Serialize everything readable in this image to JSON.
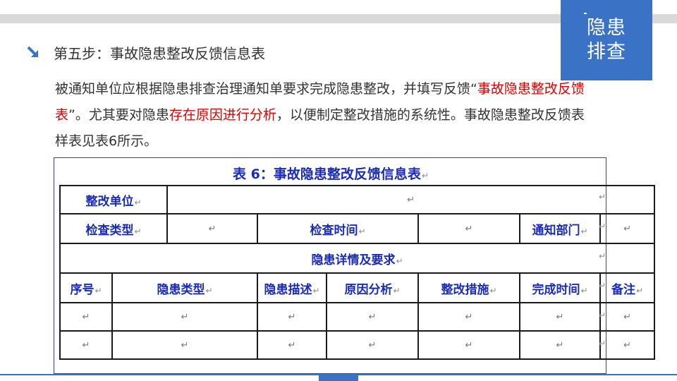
{
  "corner_tab": {
    "line1": "隐患",
    "line2": "排查"
  },
  "step": {
    "title": "第五步：事故隐患整改反馈信息表"
  },
  "paragraph": {
    "part1": "被通知单位应根据隐患排查治理通知单要求完成隐患整改，并填写反馈“",
    "red1": "事故隐患整改反馈表",
    "part2": "”。尤其要对隐患",
    "red2": "存在原因进行分析",
    "part3": "，以便制定整改措施的系统性。事故隐患整改反馈表样表见表6所示。"
  },
  "table": {
    "caption": "表 6：事故隐患整改反馈信息表",
    "row1": {
      "unit_label": "整改单位"
    },
    "row2": {
      "check_type": "检查类型",
      "check_time": "检查时间",
      "notify_dept": "通知部门"
    },
    "section": "隐患详情及要求",
    "columns": [
      "序号",
      "隐患类型",
      "隐患描述",
      "原因分析",
      "整改措施",
      "完成时间",
      "备注"
    ],
    "mark": "↵"
  },
  "colors": {
    "accent": "#3a73c6",
    "table_text": "#1a2bb8",
    "highlight": "#e00000"
  }
}
